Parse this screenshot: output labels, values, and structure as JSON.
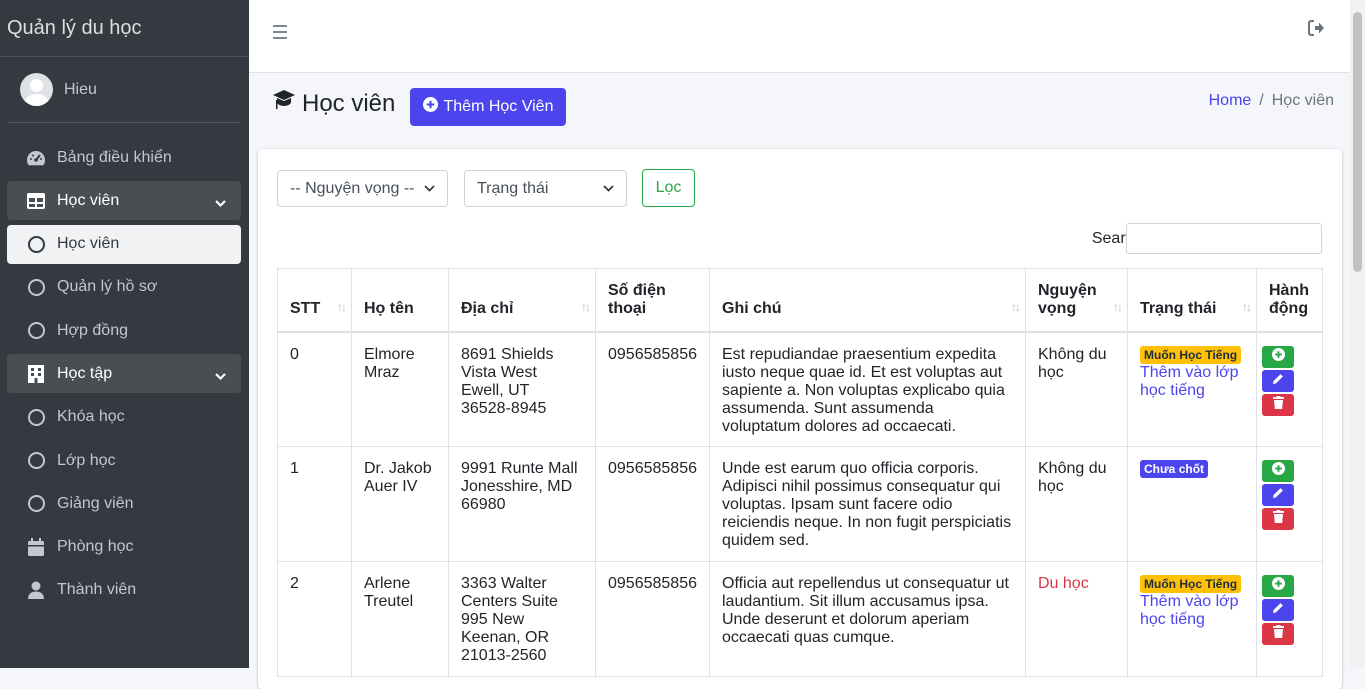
{
  "brand": "Quản lý du học",
  "user": {
    "name": "Hieu"
  },
  "sidebar": {
    "items": [
      {
        "label": "Bảng điều khiển"
      },
      {
        "label": "Học viên"
      },
      {
        "label": "Học viên"
      },
      {
        "label": "Quản lý hồ sơ"
      },
      {
        "label": "Hợp đồng"
      },
      {
        "label": "Học tập"
      },
      {
        "label": "Khóa học"
      },
      {
        "label": "Lớp học"
      },
      {
        "label": "Giảng viên"
      },
      {
        "label": "Phòng học"
      },
      {
        "label": "Thành viên"
      }
    ]
  },
  "header": {
    "title": "Học viên",
    "add_label": "Thêm Học Viên",
    "breadcrumb_home": "Home",
    "breadcrumb_sep": "/",
    "breadcrumb_current": "Học viên"
  },
  "filters": {
    "aspiration_value": "-- Nguyện vọng --",
    "status_value": "Trạng thái",
    "filter_label": "Lọc",
    "search_label": "Search:",
    "search_value": ""
  },
  "table": {
    "columns": [
      "STT",
      "Họ tên",
      "Địa chỉ",
      "Số điện thoại",
      "Ghi chú",
      "Nguyện vọng",
      "Trạng thái",
      "Hành động"
    ],
    "sort_glyph": "↑↓",
    "rows": [
      {
        "stt": "0",
        "name": "Elmore Mraz",
        "address": "8691 Shields Vista West Ewell, UT 36528-8945",
        "phone": "0956585856",
        "note": "Est repudiandae praesentium expedita iusto neque quae id. Et est voluptas aut sapiente a. Non voluptas explicabo quia assumenda. Sunt assumenda voluptatum dolores ad occaecati.",
        "aspiration": "Không du học",
        "status_badge": "Muốn Học Tiếng",
        "status_link": "Thêm vào lớp học tiếng"
      },
      {
        "stt": "1",
        "name": "Dr. Jakob Auer IV",
        "address": "9991 Runte Mall Jonesshire, MD 66980",
        "phone": "0956585856",
        "note": "Unde est earum quo officia corporis. Adipisci nihil possimus consequatur qui voluptas. Ipsam sunt facere odio reiciendis neque. In non fugit perspiciatis quidem sed.",
        "aspiration": "Không du học",
        "status_badge": "Chưa chốt",
        "status_link": ""
      },
      {
        "stt": "2",
        "name": "Arlene Treutel",
        "address": "3363 Walter Centers Suite 995 New Keenan, OR 21013-2560",
        "phone": "0956585856",
        "note": "Officia aut repellendus ut consequatur ut laudantium. Sit illum accusamus ipsa. Unde deserunt et dolorum aperiam occaecati quas cumque.",
        "aspiration": "Du học",
        "status_badge": "Muốn Học Tiếng",
        "status_link": "Thêm vào lớp học tiếng"
      }
    ]
  },
  "colors": {
    "primary": "#4c45ee",
    "success": "#28a745",
    "danger": "#dc3545",
    "warning": "#ffc107",
    "sidebar": "#343a40"
  }
}
